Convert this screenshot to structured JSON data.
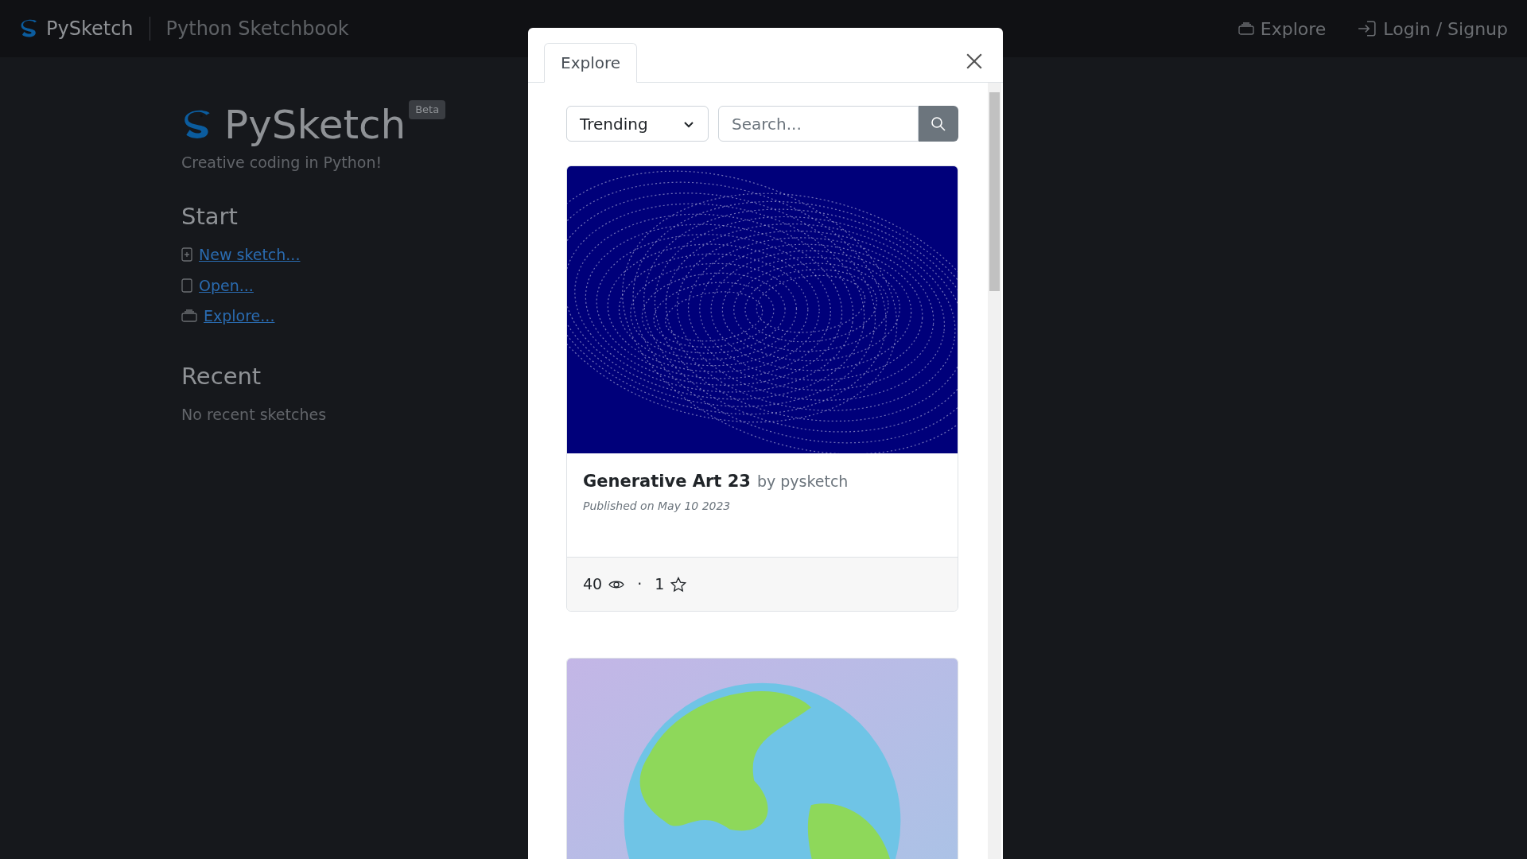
{
  "navbar": {
    "brand": "PySketch",
    "subtitle": "Python Sketchbook",
    "links": [
      {
        "kind": "explore",
        "label": "Explore"
      },
      {
        "kind": "login",
        "label": "Login / Signup"
      }
    ]
  },
  "home": {
    "title": "PySketch",
    "badge": "Beta",
    "tagline": "Creative coding in Python!",
    "start_heading": "Start",
    "start_links": [
      {
        "kind": "new",
        "label": "New sketch..."
      },
      {
        "kind": "open",
        "label": "Open..."
      },
      {
        "kind": "explore",
        "label": "Explore..."
      }
    ],
    "recent_heading": "Recent",
    "recent_empty": "No recent sketches"
  },
  "modal": {
    "tabs": [
      {
        "label": "Explore",
        "selected": true
      }
    ],
    "sort": {
      "value": "Trending"
    },
    "search": {
      "placeholder": "Search..."
    },
    "cards": [
      {
        "kind": "waves",
        "title": "Generative Art 23",
        "author": "by pysketch",
        "published": "Published on May 10 2023",
        "views": "40",
        "separator": "·",
        "stars": "1"
      },
      {
        "kind": "globe"
      }
    ]
  }
}
